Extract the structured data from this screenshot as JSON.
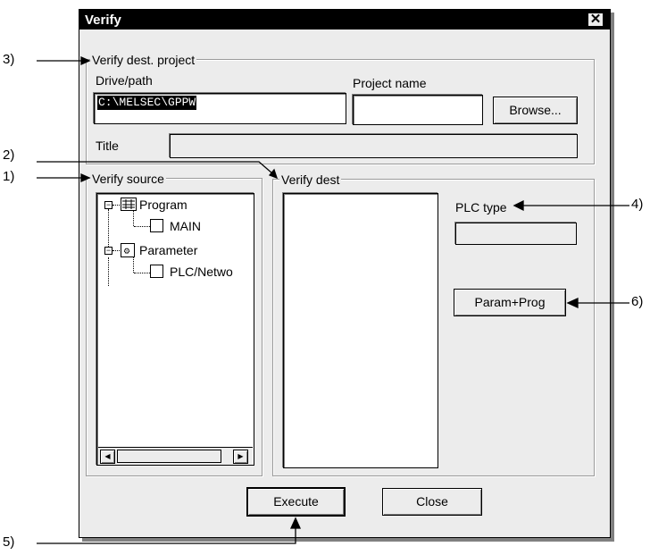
{
  "dialog": {
    "title": "Verify",
    "close_glyph": "✕"
  },
  "dest_project": {
    "group_label": "Verify dest. project",
    "drive_path_label": "Drive/path",
    "drive_path_value": "C:\\MELSEC\\GPPW",
    "project_name_label": "Project name",
    "project_name_value": "",
    "browse_label": "Browse...",
    "title_label": "Title",
    "title_value": ""
  },
  "source": {
    "group_label": "Verify source",
    "tree": {
      "program_label": "Program",
      "main_label": "MAIN",
      "parameter_label": "Parameter",
      "plc_network_label": "PLC/Netwo"
    },
    "scroll_left_glyph": "◀",
    "scroll_right_glyph": "▶"
  },
  "dest": {
    "group_label": "Verify dest",
    "plc_type_label": "PLC type",
    "plc_type_value": "",
    "param_prog_label": "Param+Prog"
  },
  "buttons": {
    "execute_label": "Execute",
    "close_label": "Close"
  },
  "callouts": [
    "1)",
    "2)",
    "3)",
    "4)",
    "5)",
    "6)"
  ],
  "icons": {
    "program": "program-icon",
    "parameter": "parameter-icon",
    "expand": "minus-expander-icon"
  },
  "colors": {
    "titlebar": "#000000",
    "dialog_bg": "#ececec"
  }
}
